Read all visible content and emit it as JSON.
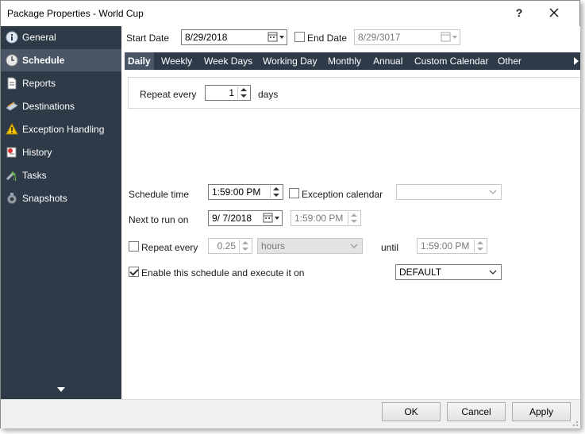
{
  "window": {
    "title": "Package Properties - World Cup",
    "help": "?",
    "close_icon": "close-icon"
  },
  "sidebar": {
    "items": [
      {
        "label": "General",
        "icon": "info-icon",
        "selected": false
      },
      {
        "label": "Schedule",
        "icon": "clock-icon",
        "selected": true
      },
      {
        "label": "Reports",
        "icon": "report-icon",
        "selected": false
      },
      {
        "label": "Destinations",
        "icon": "destination-icon",
        "selected": false
      },
      {
        "label": "Exception Handling",
        "icon": "warning-icon",
        "selected": false
      },
      {
        "label": "History",
        "icon": "history-icon",
        "selected": false
      },
      {
        "label": "Tasks",
        "icon": "tasks-icon",
        "selected": false
      },
      {
        "label": "Snapshots",
        "icon": "snapshot-icon",
        "selected": false
      }
    ]
  },
  "dates": {
    "start_label": "Start Date",
    "start_value": "8/29/2018",
    "end_label": "End Date",
    "end_value": "8/29/3017",
    "end_checked": false
  },
  "tabs": [
    {
      "label": "Daily",
      "selected": true
    },
    {
      "label": "Weekly"
    },
    {
      "label": "Week Days"
    },
    {
      "label": "Working Day"
    },
    {
      "label": "Monthly"
    },
    {
      "label": "Annual"
    },
    {
      "label": "Custom Calendar"
    },
    {
      "label": "Other"
    }
  ],
  "daily": {
    "repeat_label": "Repeat every",
    "repeat_value": "1",
    "unit": "days"
  },
  "schedule": {
    "time_label": "Schedule time",
    "time_value": "1:59:00 PM",
    "exception_label": "Exception calendar",
    "exception_checked": false,
    "exception_value": "",
    "next_label": "Next to run on",
    "next_date": "9/  7/2018",
    "next_time": "1:59:00 PM",
    "repeat_label": "Repeat every",
    "repeat_checked": false,
    "repeat_value": "0.25",
    "repeat_unit": "hours",
    "until_label": "until",
    "until_value": "1:59:00 PM",
    "enable_label": "Enable this schedule and execute it on",
    "enable_checked": true,
    "enable_value": "DEFAULT"
  },
  "footer": {
    "ok": "OK",
    "cancel": "Cancel",
    "apply": "Apply"
  },
  "colors": {
    "sidebar_bg": "#2f3a49",
    "sidebar_selected": "#4a5566"
  }
}
